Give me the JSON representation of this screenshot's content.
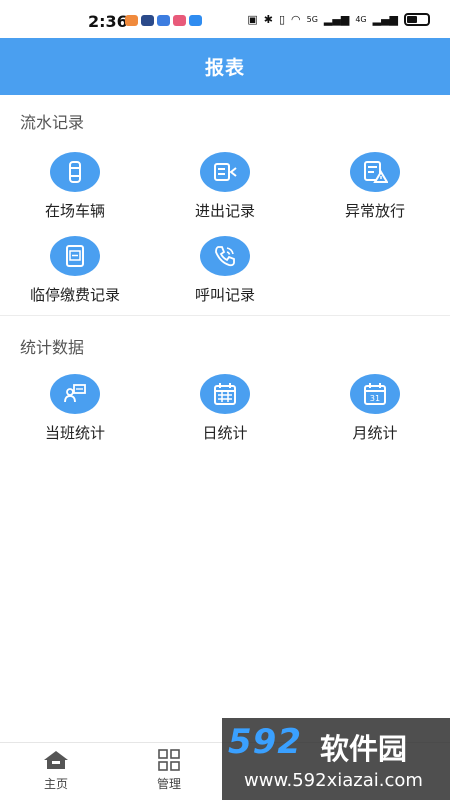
{
  "status_bar": {
    "time": "2:36",
    "network": "5G",
    "network2": "4G"
  },
  "header": {
    "title": "报表"
  },
  "sections": [
    {
      "title": "流水记录",
      "items": [
        {
          "label": "在场车辆",
          "icon": "car-icon"
        },
        {
          "label": "进出记录",
          "icon": "in-out-list-icon"
        },
        {
          "label": "异常放行",
          "icon": "exception-release-icon"
        },
        {
          "label": "临停缴费记录",
          "icon": "payment-receipt-icon"
        },
        {
          "label": "呼叫记录",
          "icon": "phone-call-icon"
        }
      ]
    },
    {
      "title": "统计数据",
      "items": [
        {
          "label": "当班统计",
          "icon": "shift-stats-icon"
        },
        {
          "label": "日统计",
          "icon": "calendar-day-icon"
        },
        {
          "label": "月统计",
          "icon": "calendar-month-icon"
        }
      ]
    }
  ],
  "calendar_number": "31",
  "tab_bar": {
    "items": [
      {
        "label": "主页",
        "icon": "home-icon"
      },
      {
        "label": "管理",
        "icon": "grid-icon"
      }
    ]
  },
  "watermark": {
    "logo": "592",
    "logo_cn": "软件园",
    "url": "www.592xiazai.com"
  },
  "colors": {
    "accent": "#4a9ff0",
    "background": "#ffffff"
  }
}
